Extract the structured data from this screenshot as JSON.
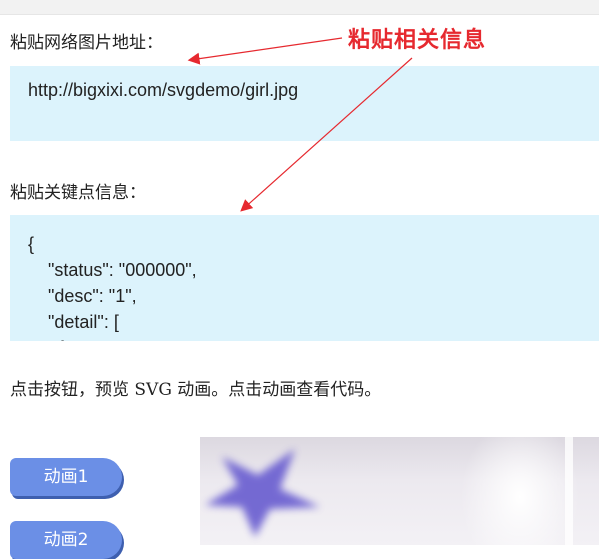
{
  "labels": {
    "url_label": "粘贴网络图片地址：",
    "keypoints_label": "粘贴关键点信息：",
    "instruction": "点击按钮，预览 SVG 动画。点击动画查看代码。"
  },
  "annotation": {
    "text": "粘贴相关信息",
    "color": "#e6292f"
  },
  "url_field": {
    "value": "http://bigxixi.com/svgdemo/girl.jpg"
  },
  "json_field": {
    "lines": [
      "{",
      "    \"status\": \"000000\",",
      "    \"desc\": \"1\",",
      "    \"detail\": [",
      "      {"
    ]
  },
  "buttons": [
    {
      "label": "动画1"
    },
    {
      "label": "动画2"
    }
  ],
  "colors": {
    "field_bg": "#dcf3fc",
    "button_bg": "#6b8fe6",
    "star": "#6a5fd0"
  }
}
